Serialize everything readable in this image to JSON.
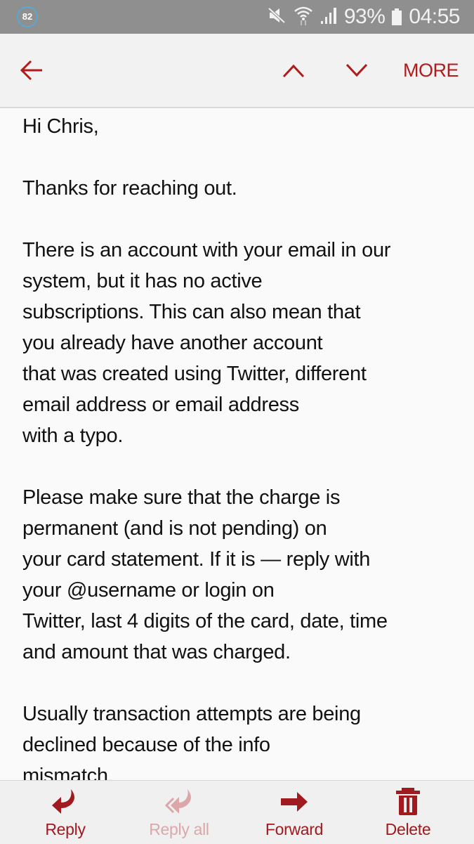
{
  "status_bar": {
    "notification_count": "82",
    "icons": [
      "mute-icon",
      "wifi-icon",
      "signal-icon",
      "battery-icon"
    ],
    "battery": "93%",
    "time": "04:55",
    "badge_color": "#56a9d0"
  },
  "action_bar": {
    "back_icon": "arrow-left-icon",
    "prev_icon": "chevron-up-icon",
    "next_icon": "chevron-down-icon",
    "more_label": "MORE",
    "accent_color": "#b01c1c"
  },
  "email": {
    "paragraphs": [
      "Hi Chris,",
      "Thanks for reaching out.",
      "There is an account with your email in our\nsystem, but it has no active\nsubscriptions. This can also mean that\nyou already have another account\nthat was created using Twitter, different\nemail address or email address\nwith a typo.",
      "Please make sure that the charge is\npermanent (and is not pending) on\nyour card statement. If it is — reply with\nyour @username or login on\nTwitter, last 4 digits of the card, date, time\nand amount that was charged.",
      "Usually transaction attempts are being\ndeclined because of the info\nmismatch."
    ]
  },
  "bottom_bar": {
    "actions": [
      {
        "label": "Reply",
        "icon": "reply-icon",
        "enabled": true
      },
      {
        "label": "Reply all",
        "icon": "reply-all-icon",
        "enabled": false
      },
      {
        "label": "Forward",
        "icon": "forward-icon",
        "enabled": true
      },
      {
        "label": "Delete",
        "icon": "trash-icon",
        "enabled": true
      }
    ],
    "active_color": "#a01a1f",
    "disabled_color": "#dba7a9"
  }
}
